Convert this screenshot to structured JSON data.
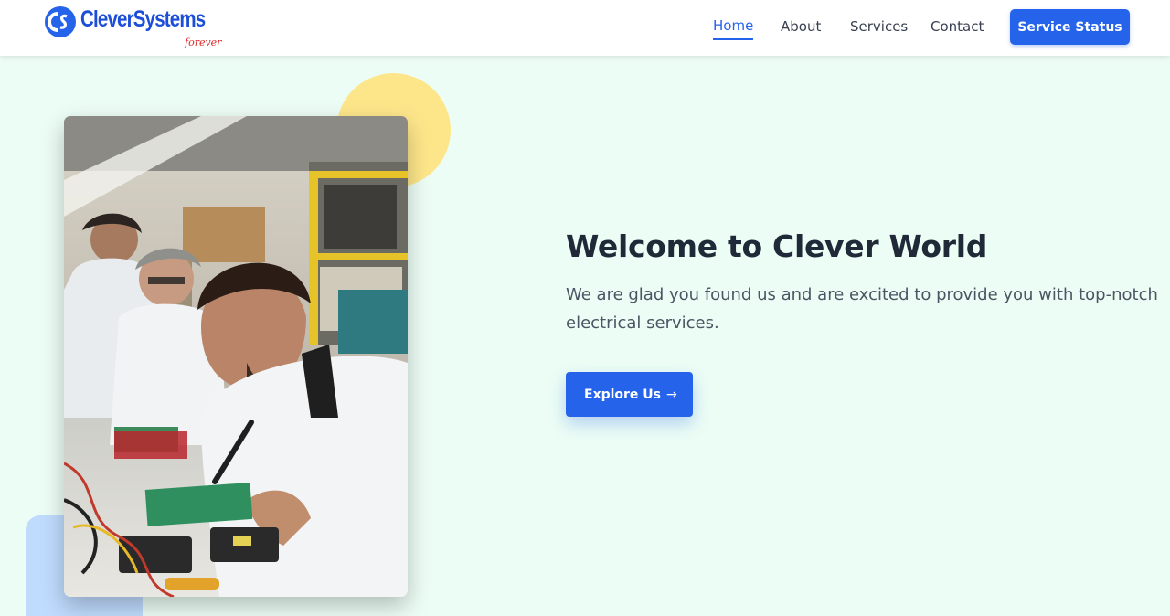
{
  "brand": {
    "name": "CleverSystems",
    "tagline": "forever",
    "primary_color": "#2563eb",
    "tagline_color": "#dc2626"
  },
  "nav": {
    "items": [
      {
        "label": "Home",
        "active": true
      },
      {
        "label": "About",
        "active": false
      },
      {
        "label": "Services",
        "active": false
      },
      {
        "label": "Contact",
        "active": false
      }
    ],
    "status_button": "Service Status"
  },
  "hero": {
    "title": "Welcome to Clever World",
    "subtitle": "We are glad you found us and are excited to provide you with top-notch electrical services.",
    "cta_label": "Explore Us",
    "cta_icon": "arrow-right-icon",
    "background_color": "#ecfdf5",
    "accent_yellow": "#fde68a",
    "accent_blue": "#bfdbfe"
  }
}
